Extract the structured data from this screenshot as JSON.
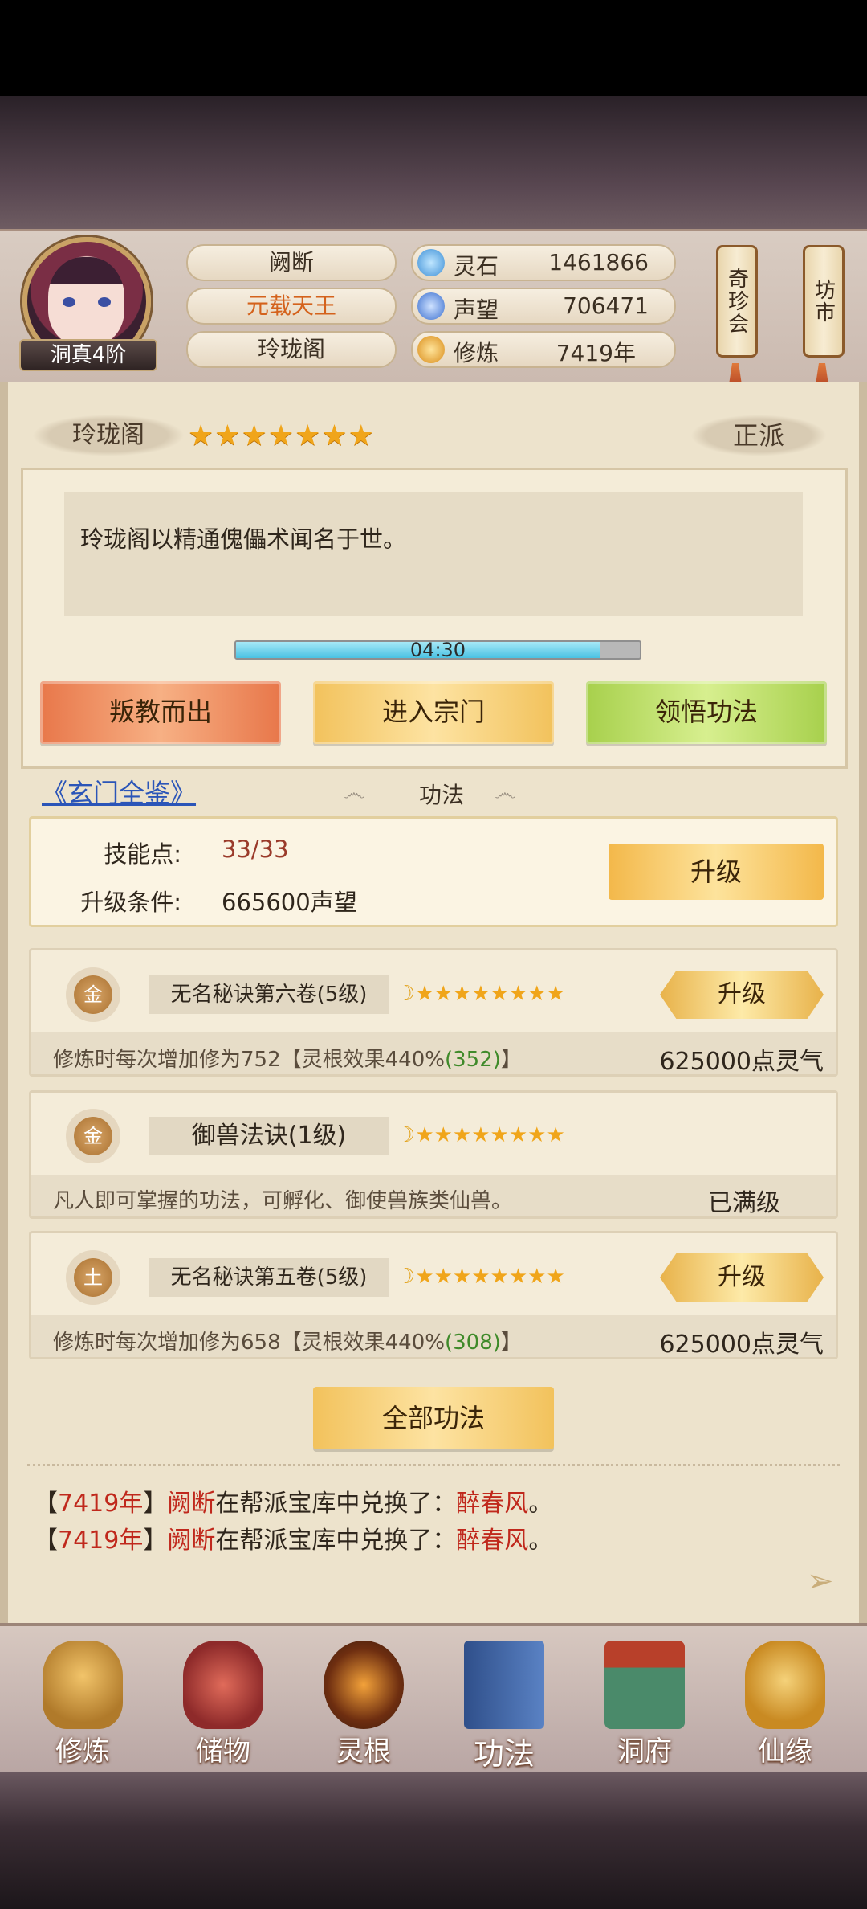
{
  "player": {
    "name": "阙断",
    "title": "元载天王",
    "sect": "玲珑阁",
    "rank": "洞真4阶"
  },
  "resources": [
    {
      "icon": "spirit-stone-icon",
      "label": "灵石",
      "value": "1461866"
    },
    {
      "icon": "prestige-icon",
      "label": "声望",
      "value": "706471"
    },
    {
      "icon": "cultivation-icon",
      "label": "修炼",
      "value": "7419年"
    }
  ],
  "side_menus": {
    "treasure": "奇珍会",
    "market": "坊市"
  },
  "sect_panel": {
    "name": "玲珑阁",
    "stars": "★★★★★★★",
    "faction": "正派",
    "description": "玲珑阁以精通傀儡术闻名于世。",
    "timer": "04:30",
    "timer_progress": 0.9,
    "buttons": {
      "leave": "叛教而出",
      "enter": "进入宗门",
      "comprehend": "领悟功法"
    }
  },
  "techniques": {
    "guide_link": "《玄门全鉴》",
    "section_title": "功法",
    "skill_points_label": "技能点:",
    "skill_points_value": "33/33",
    "upgrade_req_label": "升级条件:",
    "upgrade_req_value": "665600声望",
    "upgrade_label": "升级",
    "items": [
      {
        "grade": "金",
        "name": "无名秘诀第六卷(5级)",
        "stars": "★★★★★★★★",
        "desc_main": "修炼时每次增加修为752【灵根效果440%",
        "desc_bonus": "(352)",
        "desc_end": "】",
        "cost": "625000点灵气",
        "button": "升级"
      },
      {
        "grade": "金",
        "name": "御兽法诀(1级)",
        "stars": "★★★★★★★★",
        "desc_main": "凡人即可掌握的功法，可孵化、御使兽族类仙兽。",
        "desc_bonus": "",
        "desc_end": "",
        "cost": "已满级",
        "button": ""
      },
      {
        "grade": "土",
        "name": "无名秘诀第五卷(5级)",
        "stars": "★★★★★★★★",
        "desc_main": "修炼时每次增加修为658【灵根效果440%",
        "desc_bonus": "(308)",
        "desc_end": "】",
        "cost": "625000点灵气",
        "button": "升级"
      }
    ],
    "all_button": "全部功法"
  },
  "logs": [
    {
      "open": "【",
      "year": "7419年",
      "close": "】",
      "player": "阙断",
      "text": "在帮派宝库中兑换了：",
      "item": "醉春风",
      "end": "。"
    },
    {
      "open": "【",
      "year": "7419年",
      "close": "】",
      "player": "阙断",
      "text": "在帮派宝库中兑换了：",
      "item": "醉春风",
      "end": "。"
    }
  ],
  "nav": [
    {
      "icon": "cultivate-icon",
      "label": "修炼"
    },
    {
      "icon": "storage-bag-icon",
      "label": "储物"
    },
    {
      "icon": "spirit-root-icon",
      "label": "灵根"
    },
    {
      "icon": "technique-book-icon",
      "label": "功法"
    },
    {
      "icon": "cave-mansion-icon",
      "label": "洞府"
    },
    {
      "icon": "immortal-fate-icon",
      "label": "仙缘"
    }
  ],
  "colors": {
    "accent_gold": "#f2c25c",
    "link_blue": "#2b55b8",
    "log_red": "#c0281c",
    "bonus_green": "#3f8a2a"
  }
}
